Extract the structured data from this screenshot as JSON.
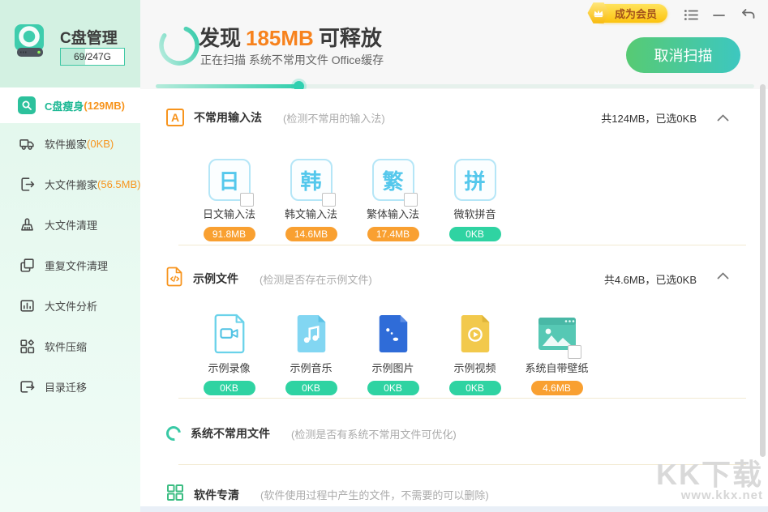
{
  "app": {
    "title": "C盘管理",
    "capacity_used": "69/247G"
  },
  "titlebar": {
    "vip_label": "成为会员"
  },
  "sidebar": {
    "items": [
      {
        "label": "C盘瘦身",
        "size": "(129MB)"
      },
      {
        "label": "软件搬家",
        "size": "(0KB)"
      },
      {
        "label": "大文件搬家",
        "size": "(56.5MB)"
      },
      {
        "label": "大文件清理",
        "size": ""
      },
      {
        "label": "重复文件清理",
        "size": ""
      },
      {
        "label": "大文件分析",
        "size": ""
      },
      {
        "label": "软件压缩",
        "size": ""
      },
      {
        "label": "目录迁移",
        "size": ""
      }
    ]
  },
  "scan": {
    "found_prefix": "发现",
    "found_size": "185MB",
    "found_suffix": "可释放",
    "status": "正在扫描 系统不常用文件 Office缓存",
    "cancel_label": "取消扫描",
    "progress_percent": 24
  },
  "sections": [
    {
      "title": "不常用输入法",
      "desc": "(检测不常用的输入法)",
      "stats": "共124MB，已选0KB",
      "icon_glyph": "A",
      "items": [
        {
          "glyph": "日",
          "label": "日文输入法",
          "size": "91.8MB"
        },
        {
          "glyph": "韩",
          "label": "韩文输入法",
          "size": "14.6MB"
        },
        {
          "glyph": "繁",
          "label": "繁体输入法",
          "size": "17.4MB"
        },
        {
          "glyph": "拼",
          "label": "微软拼音",
          "size": "0KB"
        }
      ]
    },
    {
      "title": "示例文件",
      "desc": "(检测是否存在示例文件)",
      "stats": "共4.6MB，已选0KB",
      "items": [
        {
          "icon": "sample-video-rec-icon",
          "label": "示例录像",
          "size": "0KB"
        },
        {
          "icon": "sample-music-icon",
          "label": "示例音乐",
          "size": "0KB"
        },
        {
          "icon": "sample-picture-icon",
          "label": "示例图片",
          "size": "0KB"
        },
        {
          "icon": "sample-movie-icon",
          "label": "示例视频",
          "size": "0KB"
        },
        {
          "icon": "system-wallpaper-icon",
          "label": "系统自带壁纸",
          "size": "4.6MB"
        }
      ]
    },
    {
      "title": "系统不常用文件",
      "desc": "(检测是否有系统不常用文件可优化)"
    },
    {
      "title": "软件专清",
      "desc": "(软件使用过程中产生的文件，不需要的可以删除)"
    }
  ],
  "watermark": {
    "line1": "KK下载",
    "line2": "www.kkx.net"
  },
  "colors": {
    "accent_teal": "#2fc9a7",
    "accent_orange": "#f7941d",
    "badge_green": "#2fd3a2",
    "vip_gold": "#fcc40f"
  }
}
